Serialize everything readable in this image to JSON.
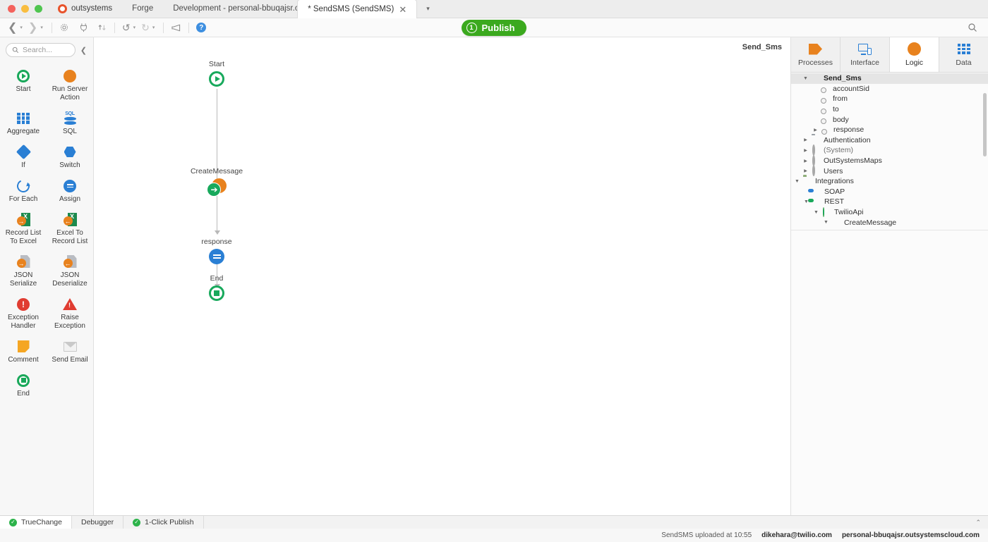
{
  "window": {
    "brand": "outsystems",
    "menus": [
      "Forge",
      "Development - personal-bbuqajsr.o..."
    ],
    "active_tab": "* SendSMS (SendSMS)",
    "tab_close_glyph": "✕",
    "tab_overflow_glyph": "▾"
  },
  "toolbar": {
    "back_glyph": "❮",
    "forward_glyph": "❯",
    "caret_glyph": "▾",
    "gear_icon": "gear-icon",
    "plug_icon": "plug-icon",
    "sort_icon": "sort-icon",
    "undo_glyph": "↺",
    "redo_glyph": "↻",
    "feedback_icon": "megaphone-icon",
    "help_glyph": "?",
    "search_glyph": "⌕",
    "publish_label": "Publish",
    "publish_count": "1",
    "publish_color": "#3ba91e"
  },
  "toolbox": {
    "search_placeholder": "Search...",
    "collapse_glyph": "❮",
    "items": [
      {
        "label": "Start",
        "icon": "start-icon"
      },
      {
        "label": "Run Server\nAction",
        "icon": "run-server-action-icon"
      },
      {
        "label": "Aggregate",
        "icon": "aggregate-icon"
      },
      {
        "label": "SQL",
        "icon": "sql-icon"
      },
      {
        "label": "If",
        "icon": "if-icon"
      },
      {
        "label": "Switch",
        "icon": "switch-icon"
      },
      {
        "label": "For Each",
        "icon": "for-each-icon"
      },
      {
        "label": "Assign",
        "icon": "assign-icon"
      },
      {
        "label": "Record List\nTo Excel",
        "icon": "record-list-to-excel-icon"
      },
      {
        "label": "Excel To\nRecord List",
        "icon": "excel-to-record-list-icon"
      },
      {
        "label": "JSON\nSerialize",
        "icon": "json-serialize-icon"
      },
      {
        "label": "JSON\nDeserialize",
        "icon": "json-deserialize-icon"
      },
      {
        "label": "Exception\nHandler",
        "icon": "exception-handler-icon"
      },
      {
        "label": "Raise\nException",
        "icon": "raise-exception-icon"
      },
      {
        "label": "Comment",
        "icon": "comment-icon"
      },
      {
        "label": "Send Email",
        "icon": "send-email-icon"
      },
      {
        "label": "End",
        "icon": "end-icon"
      }
    ]
  },
  "canvas": {
    "title": "Send_Sms",
    "nodes": [
      {
        "label": "Start",
        "type": "start"
      },
      {
        "label": "CreateMessage",
        "type": "action"
      },
      {
        "label": "response",
        "type": "assign"
      },
      {
        "label": "End",
        "type": "end"
      }
    ]
  },
  "right_panel": {
    "tabs": [
      {
        "label": "Processes",
        "icon": "processes-icon",
        "active": false
      },
      {
        "label": "Interface",
        "icon": "interface-icon",
        "active": false
      },
      {
        "label": "Logic",
        "icon": "logic-icon",
        "active": true
      },
      {
        "label": "Data",
        "icon": "data-icon",
        "active": false
      }
    ],
    "tree": [
      {
        "label": "Send_Sms",
        "icon": "orange-dot-icon",
        "indent": 1,
        "twist": "open",
        "bold": true,
        "selected": true
      },
      {
        "label": "accountSid",
        "icon": "parameter-icon",
        "indent": 3,
        "twist": "none"
      },
      {
        "label": "from",
        "icon": "parameter-icon",
        "indent": 3,
        "twist": "none"
      },
      {
        "label": "to",
        "icon": "parameter-icon",
        "indent": 3,
        "twist": "none"
      },
      {
        "label": "body",
        "icon": "parameter-icon",
        "indent": 3,
        "twist": "none"
      },
      {
        "label": "response",
        "icon": "parameter-icon",
        "indent": 2,
        "twist": "closed"
      },
      {
        "label": "Authentication",
        "icon": "folder-icon",
        "indent": 1,
        "twist": "closed"
      },
      {
        "label": "(System)",
        "icon": "ring-icon",
        "indent": 1,
        "twist": "closed",
        "muted": true
      },
      {
        "label": "OutSystemsMaps",
        "icon": "ring-icon",
        "indent": 1,
        "twist": "closed"
      },
      {
        "label": "Users",
        "icon": "ring-icon",
        "indent": 1,
        "twist": "closed"
      },
      {
        "label": "Integrations",
        "icon": "folder-green-icon",
        "indent": 0,
        "twist": "open"
      },
      {
        "label": "SOAP",
        "icon": "soap-icon",
        "indent": 2,
        "twist": "none"
      },
      {
        "label": "REST",
        "icon": "rest-icon",
        "indent": 1,
        "twist": "open"
      },
      {
        "label": "TwilioApi",
        "icon": "api-icon",
        "indent": 2,
        "twist": "open"
      },
      {
        "label": "CreateMessage",
        "icon": "orange-dot-icon",
        "indent": 3,
        "twist": "open"
      }
    ]
  },
  "bottom_bar": {
    "tabs": [
      {
        "label": "TrueChange",
        "status": "ok",
        "active": true
      },
      {
        "label": "Debugger",
        "status": "none",
        "active": false
      },
      {
        "label": "1-Click Publish",
        "status": "ok",
        "active": false
      }
    ],
    "collapse_glyph": "⌃",
    "check_glyph": "✓"
  },
  "status_bar": {
    "upload_message": "SendSMS uploaded at 10:55",
    "user_email": "dikehara@twilio.com",
    "environment": "personal-bbuqajsr.outsystemscloud.com"
  }
}
